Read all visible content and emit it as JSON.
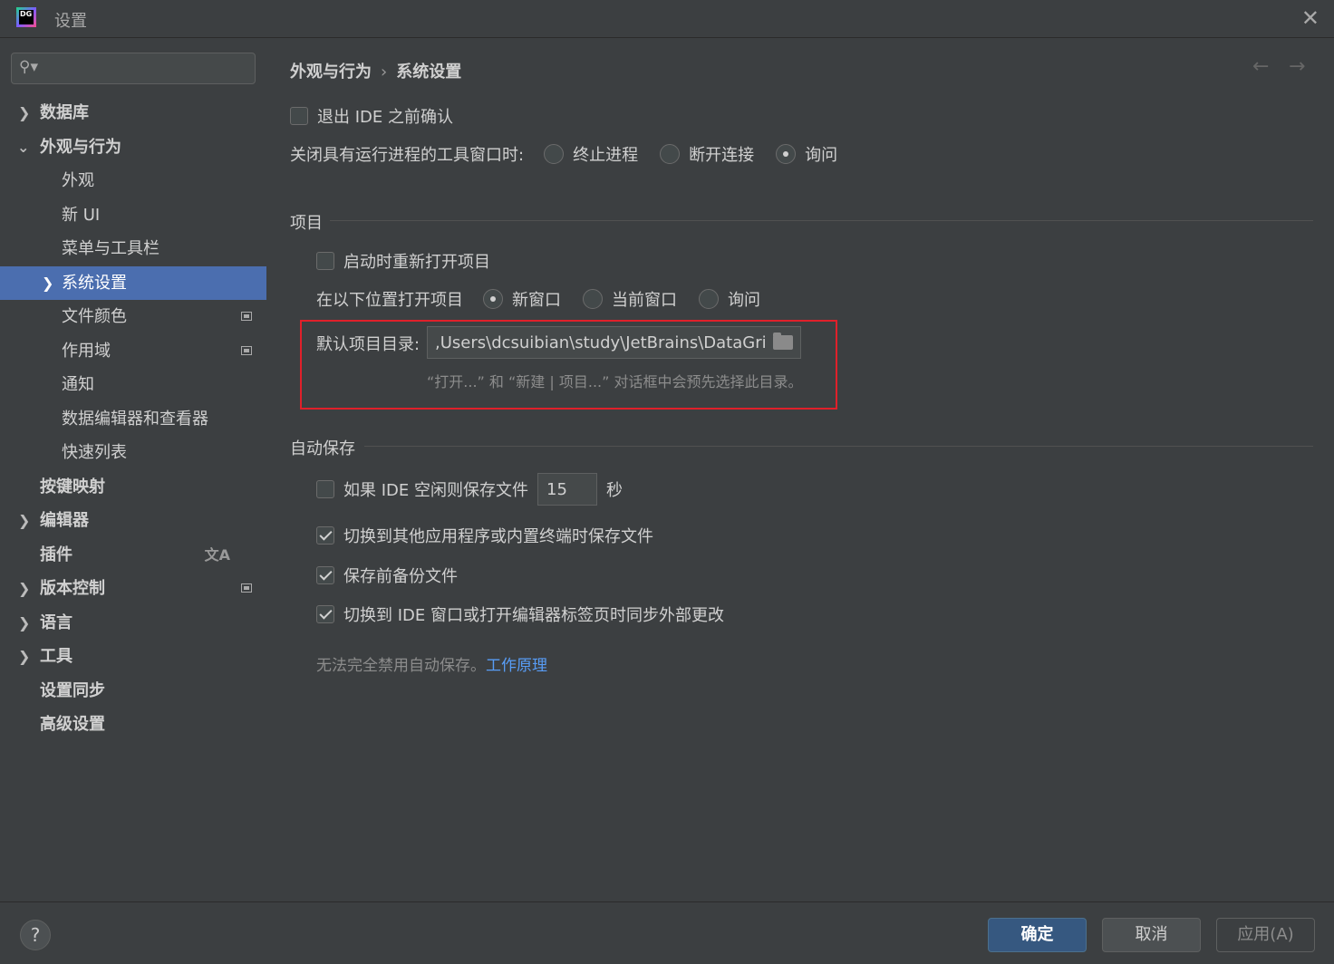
{
  "window": {
    "title": "设置",
    "logo_text": "DG"
  },
  "sidebar": {
    "search_placeholder": "",
    "items": [
      {
        "label": "数据库"
      },
      {
        "label": "外观与行为"
      },
      {
        "label": "外观"
      },
      {
        "label": "新 UI"
      },
      {
        "label": "菜单与工具栏"
      },
      {
        "label": "系统设置"
      },
      {
        "label": "文件颜色"
      },
      {
        "label": "作用域"
      },
      {
        "label": "通知"
      },
      {
        "label": "数据编辑器和查看器"
      },
      {
        "label": "快速列表"
      },
      {
        "label": "按键映射"
      },
      {
        "label": "编辑器"
      },
      {
        "label": "插件"
      },
      {
        "label": "版本控制"
      },
      {
        "label": "语言"
      },
      {
        "label": "工具"
      },
      {
        "label": "设置同步"
      },
      {
        "label": "高级设置"
      }
    ]
  },
  "main": {
    "breadcrumb": {
      "parent": "外观与行为",
      "separator": "›",
      "current": "系统设置"
    },
    "confirm_exit": {
      "label": "退出 IDE 之前确认",
      "checked": false
    },
    "close_tool_window": {
      "label": "关闭具有运行进程的工具窗口时:",
      "options": [
        "终止进程",
        "断开连接",
        "询问"
      ],
      "selected": "询问"
    },
    "project_section": {
      "title": "项目",
      "reopen_on_startup": {
        "label": "启动时重新打开项目",
        "checked": false
      },
      "open_location": {
        "label": "在以下位置打开项目",
        "options": [
          "新窗口",
          "当前窗口",
          "询问"
        ],
        "selected": "新窗口"
      },
      "default_dir": {
        "label": "默认项目目录:",
        "value": ",Users\\dcsuibian\\study\\JetBrains\\DataGrip",
        "hint": "“打开...” 和 “新建 | 项目...” 对话框中会预先选择此目录。"
      }
    },
    "autosave_section": {
      "title": "自动保存",
      "idle_save": {
        "label": "如果 IDE 空闲则保存文件",
        "value": "15",
        "unit": "秒",
        "checked": false
      },
      "switch_save": {
        "label": "切换到其他应用程序或内置终端时保存文件",
        "checked": true
      },
      "backup": {
        "label": "保存前备份文件",
        "checked": true
      },
      "sync": {
        "label": "切换到 IDE 窗口或打开编辑器标签页时同步外部更改",
        "checked": true
      },
      "note": "无法完全禁用自动保存。",
      "note_link": "工作原理"
    }
  },
  "footer": {
    "help": "?",
    "ok": "确定",
    "cancel": "取消",
    "apply": "应用(A)"
  },
  "colors": {
    "selection": "#4b6eaf",
    "highlight_box": "#e0202a",
    "link": "#589df6"
  }
}
